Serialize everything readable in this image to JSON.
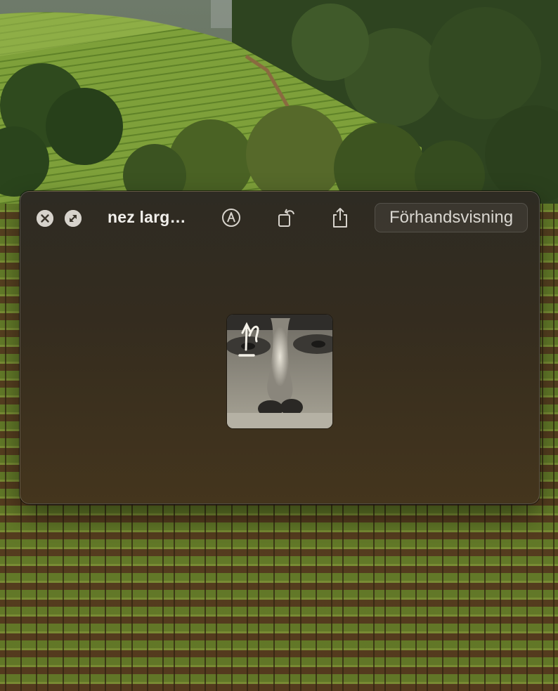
{
  "window": {
    "title": "nez larg…",
    "open_button_label": "Förhandsvisning"
  },
  "toolbar": {
    "close": {
      "icon": "close-icon"
    },
    "fullscreen": {
      "icon": "fullscreen-icon"
    },
    "markup": {
      "icon": "markup-icon"
    },
    "rotate": {
      "icon": "rotate-icon"
    },
    "share": {
      "icon": "share-icon"
    }
  },
  "preview": {
    "content": "photo-thumbnail"
  },
  "colors": {
    "window_top": "#2e2b23",
    "window_bottom": "#44351d",
    "text": "#f2f0ec",
    "button_text": "#d9d6d0",
    "icon": "#d7d3cc"
  }
}
